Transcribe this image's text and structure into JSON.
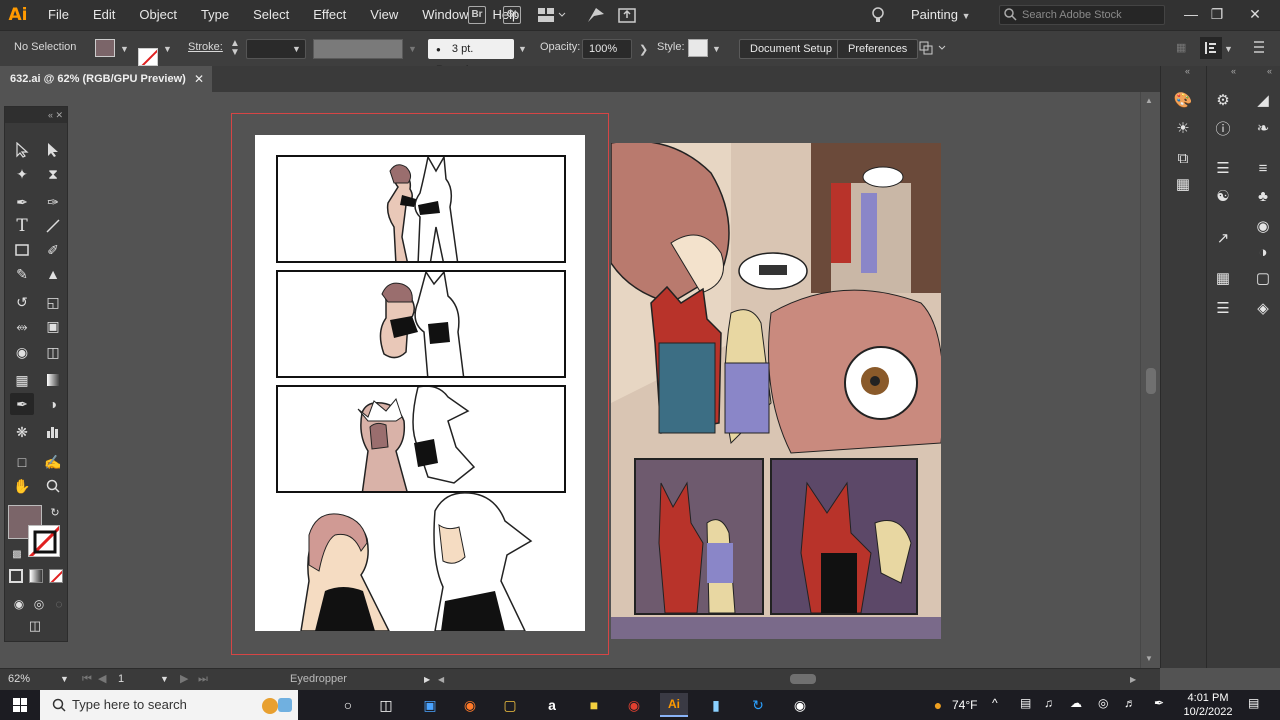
{
  "app": {
    "logo": "Ai"
  },
  "menu": [
    "File",
    "Edit",
    "Object",
    "Type",
    "Select",
    "Effect",
    "View",
    "Window",
    "Help"
  ],
  "menubar_icons": {
    "bridge": "Br",
    "stock": "St"
  },
  "workspace": {
    "label": "Painting"
  },
  "search": {
    "placeholder": "Search Adobe Stock"
  },
  "control": {
    "selection": "No Selection",
    "stroke_label": "Stroke:",
    "brush": "3 pt. Round",
    "opacity_label": "Opacity:",
    "opacity_value": "100%",
    "style_label": "Style:",
    "doc_setup": "Document Setup",
    "preferences": "Preferences"
  },
  "document": {
    "tab_title": "632.ai @ 62% (RGB/GPU Preview)"
  },
  "status": {
    "zoom": "62%",
    "artboard": "1",
    "tool": "Eyedropper"
  },
  "colors": {
    "fill": "#7b6569",
    "accent": "#ff9a00",
    "artboard_border": "#d64545"
  },
  "taskbar": {
    "search_placeholder": "Type here to search",
    "weather": "74°F",
    "time": "4:01 PM",
    "date": "10/2/2022"
  },
  "icons": {
    "tools": [
      "selection-arrow",
      "direct-selection",
      "magic-wand",
      "lasso",
      "pen",
      "curvature",
      "type",
      "line-segment",
      "rectangle",
      "paintbrush",
      "pencil",
      "eraser",
      "rotate",
      "scale",
      "width",
      "free-transform",
      "shape-builder",
      "perspective-grid",
      "mesh",
      "gradient",
      "eyedropper",
      "blend",
      "symbol-sprayer",
      "column-graph",
      "artboard",
      "slice",
      "hand",
      "zoom"
    ]
  }
}
